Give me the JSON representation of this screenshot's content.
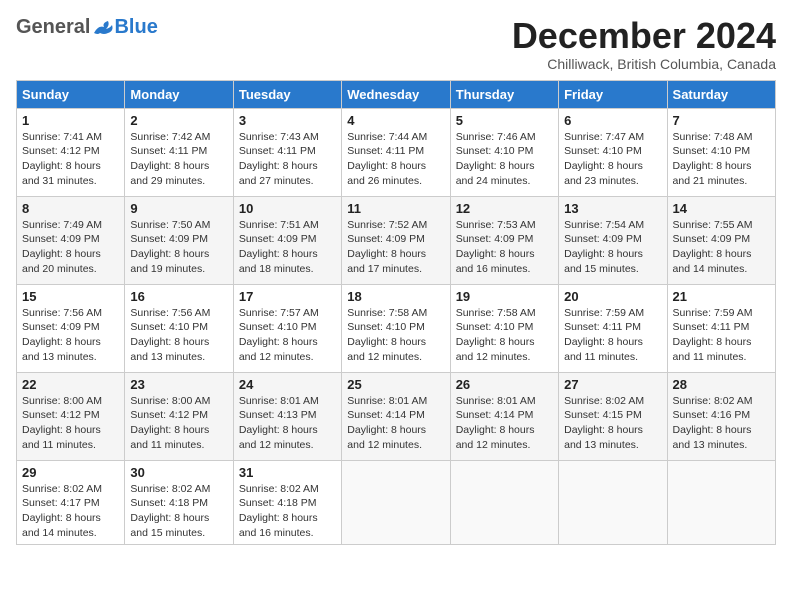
{
  "header": {
    "logo": {
      "general": "General",
      "blue": "Blue"
    },
    "title": "December 2024",
    "location": "Chilliwack, British Columbia, Canada"
  },
  "calendar": {
    "columns": [
      "Sunday",
      "Monday",
      "Tuesday",
      "Wednesday",
      "Thursday",
      "Friday",
      "Saturday"
    ],
    "weeks": [
      [
        {
          "day": "1",
          "sunrise": "7:41 AM",
          "sunset": "4:12 PM",
          "daylight": "8 hours and 31 minutes."
        },
        {
          "day": "2",
          "sunrise": "7:42 AM",
          "sunset": "4:11 PM",
          "daylight": "8 hours and 29 minutes."
        },
        {
          "day": "3",
          "sunrise": "7:43 AM",
          "sunset": "4:11 PM",
          "daylight": "8 hours and 27 minutes."
        },
        {
          "day": "4",
          "sunrise": "7:44 AM",
          "sunset": "4:11 PM",
          "daylight": "8 hours and 26 minutes."
        },
        {
          "day": "5",
          "sunrise": "7:46 AM",
          "sunset": "4:10 PM",
          "daylight": "8 hours and 24 minutes."
        },
        {
          "day": "6",
          "sunrise": "7:47 AM",
          "sunset": "4:10 PM",
          "daylight": "8 hours and 23 minutes."
        },
        {
          "day": "7",
          "sunrise": "7:48 AM",
          "sunset": "4:10 PM",
          "daylight": "8 hours and 21 minutes."
        }
      ],
      [
        {
          "day": "8",
          "sunrise": "7:49 AM",
          "sunset": "4:09 PM",
          "daylight": "8 hours and 20 minutes."
        },
        {
          "day": "9",
          "sunrise": "7:50 AM",
          "sunset": "4:09 PM",
          "daylight": "8 hours and 19 minutes."
        },
        {
          "day": "10",
          "sunrise": "7:51 AM",
          "sunset": "4:09 PM",
          "daylight": "8 hours and 18 minutes."
        },
        {
          "day": "11",
          "sunrise": "7:52 AM",
          "sunset": "4:09 PM",
          "daylight": "8 hours and 17 minutes."
        },
        {
          "day": "12",
          "sunrise": "7:53 AM",
          "sunset": "4:09 PM",
          "daylight": "8 hours and 16 minutes."
        },
        {
          "day": "13",
          "sunrise": "7:54 AM",
          "sunset": "4:09 PM",
          "daylight": "8 hours and 15 minutes."
        },
        {
          "day": "14",
          "sunrise": "7:55 AM",
          "sunset": "4:09 PM",
          "daylight": "8 hours and 14 minutes."
        }
      ],
      [
        {
          "day": "15",
          "sunrise": "7:56 AM",
          "sunset": "4:09 PM",
          "daylight": "8 hours and 13 minutes."
        },
        {
          "day": "16",
          "sunrise": "7:56 AM",
          "sunset": "4:10 PM",
          "daylight": "8 hours and 13 minutes."
        },
        {
          "day": "17",
          "sunrise": "7:57 AM",
          "sunset": "4:10 PM",
          "daylight": "8 hours and 12 minutes."
        },
        {
          "day": "18",
          "sunrise": "7:58 AM",
          "sunset": "4:10 PM",
          "daylight": "8 hours and 12 minutes."
        },
        {
          "day": "19",
          "sunrise": "7:58 AM",
          "sunset": "4:10 PM",
          "daylight": "8 hours and 12 minutes."
        },
        {
          "day": "20",
          "sunrise": "7:59 AM",
          "sunset": "4:11 PM",
          "daylight": "8 hours and 11 minutes."
        },
        {
          "day": "21",
          "sunrise": "7:59 AM",
          "sunset": "4:11 PM",
          "daylight": "8 hours and 11 minutes."
        }
      ],
      [
        {
          "day": "22",
          "sunrise": "8:00 AM",
          "sunset": "4:12 PM",
          "daylight": "8 hours and 11 minutes."
        },
        {
          "day": "23",
          "sunrise": "8:00 AM",
          "sunset": "4:12 PM",
          "daylight": "8 hours and 11 minutes."
        },
        {
          "day": "24",
          "sunrise": "8:01 AM",
          "sunset": "4:13 PM",
          "daylight": "8 hours and 12 minutes."
        },
        {
          "day": "25",
          "sunrise": "8:01 AM",
          "sunset": "4:14 PM",
          "daylight": "8 hours and 12 minutes."
        },
        {
          "day": "26",
          "sunrise": "8:01 AM",
          "sunset": "4:14 PM",
          "daylight": "8 hours and 12 minutes."
        },
        {
          "day": "27",
          "sunrise": "8:02 AM",
          "sunset": "4:15 PM",
          "daylight": "8 hours and 13 minutes."
        },
        {
          "day": "28",
          "sunrise": "8:02 AM",
          "sunset": "4:16 PM",
          "daylight": "8 hours and 13 minutes."
        }
      ],
      [
        {
          "day": "29",
          "sunrise": "8:02 AM",
          "sunset": "4:17 PM",
          "daylight": "8 hours and 14 minutes."
        },
        {
          "day": "30",
          "sunrise": "8:02 AM",
          "sunset": "4:18 PM",
          "daylight": "8 hours and 15 minutes."
        },
        {
          "day": "31",
          "sunrise": "8:02 AM",
          "sunset": "4:18 PM",
          "daylight": "8 hours and 16 minutes."
        },
        null,
        null,
        null,
        null
      ]
    ]
  }
}
